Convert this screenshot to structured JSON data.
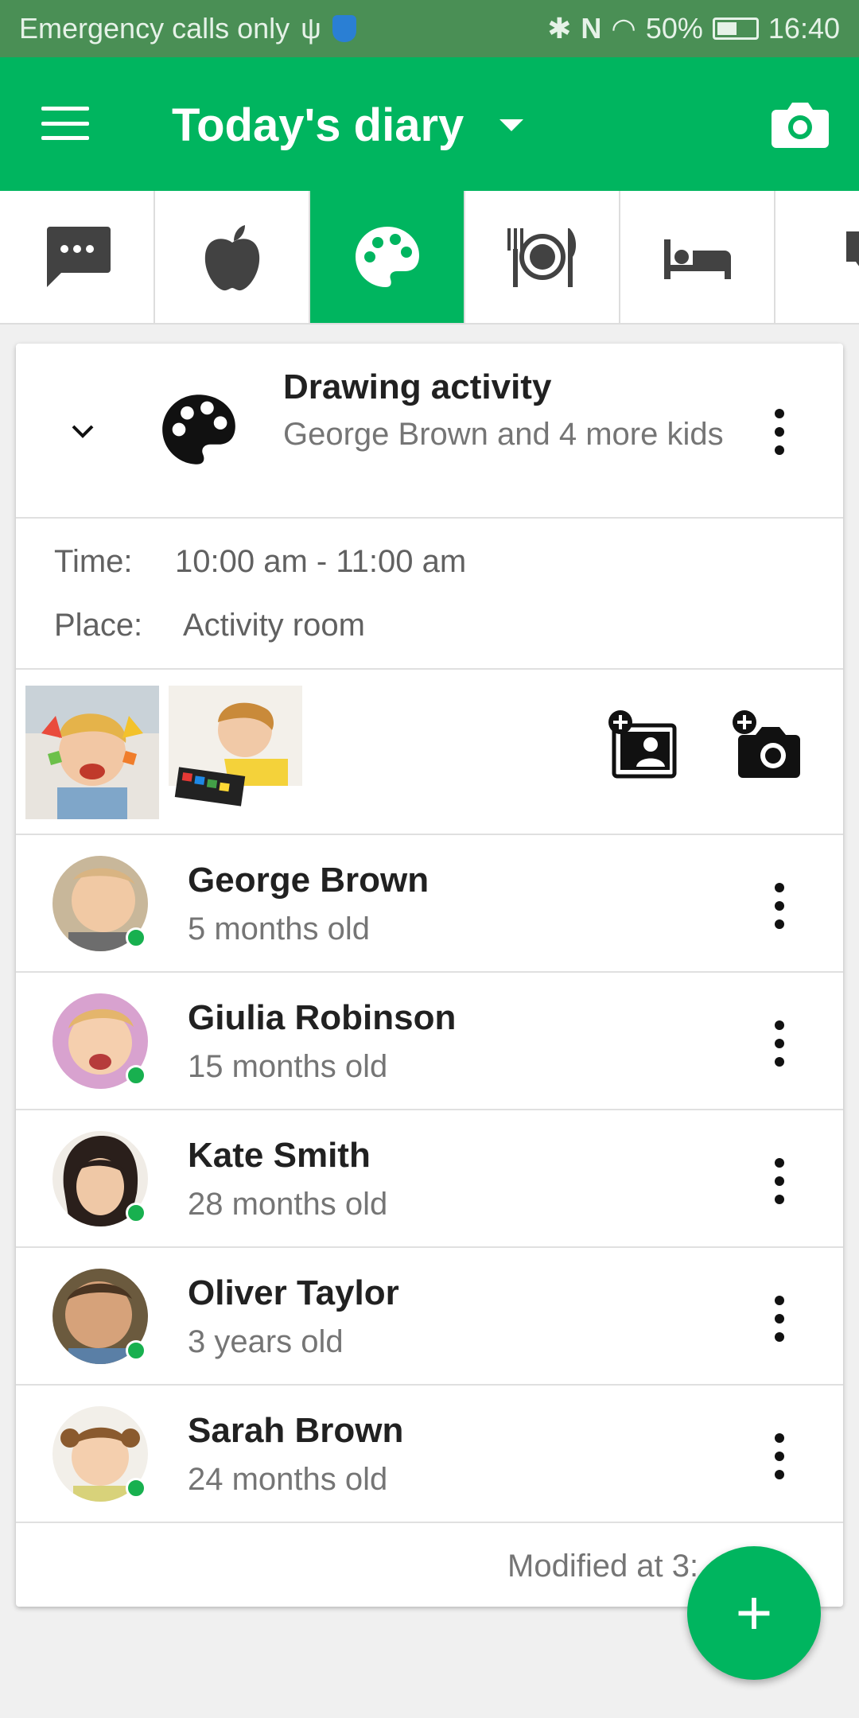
{
  "status_bar": {
    "carrier_text": "Emergency calls only",
    "battery": "50%",
    "time": "16:40"
  },
  "app_bar": {
    "title": "Today's diary"
  },
  "tabs": [
    {
      "icon": "chat-bubble-icon",
      "active": false
    },
    {
      "icon": "apple-icon",
      "active": false
    },
    {
      "icon": "palette-icon",
      "active": true
    },
    {
      "icon": "meal-icon",
      "active": false
    },
    {
      "icon": "bed-icon",
      "active": false
    },
    {
      "icon": "diaper-icon",
      "active": false
    }
  ],
  "activity": {
    "title": "Drawing activity",
    "subtitle": "George Brown and 4 more kids",
    "time_label": "Time:",
    "time_value": "10:00 am - 11:00 am",
    "place_label": "Place:",
    "place_value": "Activity room"
  },
  "kids": [
    {
      "name": "George Brown",
      "age": "5 months old"
    },
    {
      "name": "Giulia Robinson",
      "age": "15 months old"
    },
    {
      "name": "Kate Smith",
      "age": "28 months old"
    },
    {
      "name": "Oliver Taylor",
      "age": "3 years old"
    },
    {
      "name": "Sarah Brown",
      "age": "24 months old"
    }
  ],
  "footer": {
    "modified": "Modified at 3:"
  },
  "fab": {
    "label": "+"
  },
  "colors": {
    "primary": "#00b55f",
    "status_bar": "#4a8f55",
    "online": "#18b04f"
  }
}
